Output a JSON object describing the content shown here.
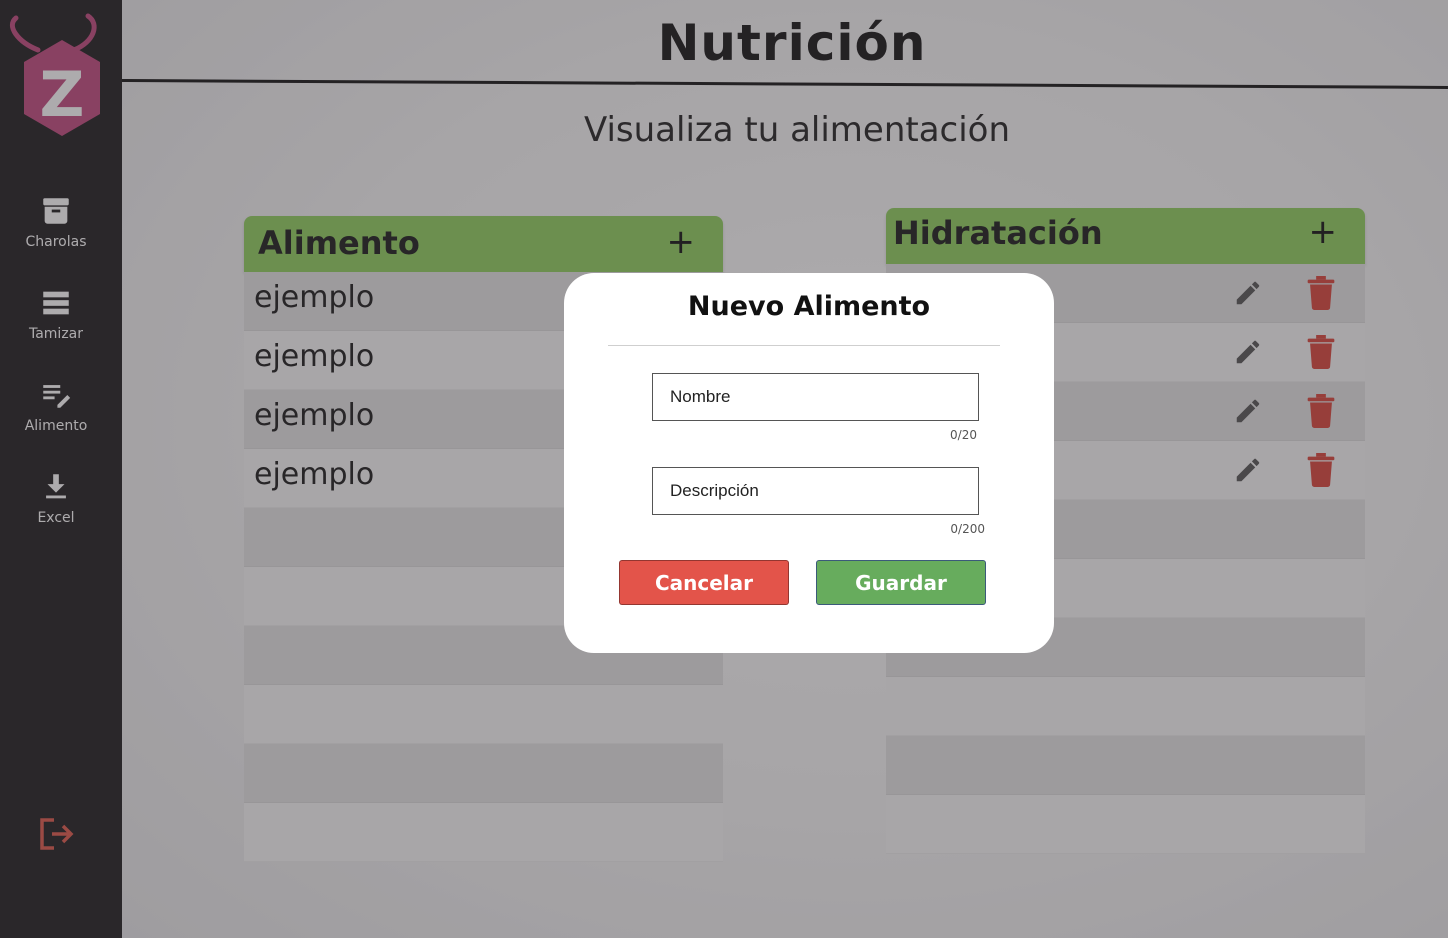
{
  "app": {
    "logo_letter": "Z"
  },
  "sidebar": {
    "items": [
      {
        "label": "Charolas",
        "icon": "archive-icon"
      },
      {
        "label": "Tamizar",
        "icon": "list-icon"
      },
      {
        "label": "Alimento",
        "icon": "edit-note-icon"
      },
      {
        "label": "Excel",
        "icon": "download-icon"
      }
    ],
    "logout_icon": "logout-icon"
  },
  "header": {
    "title": "Nutrición",
    "subtitle": "Visualiza tu alimentación"
  },
  "food_panel": {
    "title": "Alimento",
    "add_symbol": "+",
    "rows": [
      "ejemplo",
      "ejemplo",
      "ejemplo",
      "ejemplo",
      "",
      "",
      "",
      "",
      "",
      ""
    ]
  },
  "hydration_panel": {
    "title": "Hidratación",
    "add_symbol": "+",
    "rows": [
      "",
      "",
      "",
      "",
      "",
      "",
      "",
      "",
      "",
      ""
    ],
    "rows_with_actions": 4
  },
  "modal": {
    "title": "Nuevo Alimento",
    "name_placeholder": "Nombre",
    "name_counter": "0/20",
    "description_placeholder": "Descripción",
    "description_counter": "0/200",
    "cancel_label": "Cancelar",
    "save_label": "Guardar"
  },
  "colors": {
    "sidebar": "#1e1c1e",
    "panel_header": "#8fcf5e",
    "cancel": "#e3544a",
    "save": "#67ac5d",
    "delete": "#d9443a",
    "logo": "#c2497e"
  }
}
